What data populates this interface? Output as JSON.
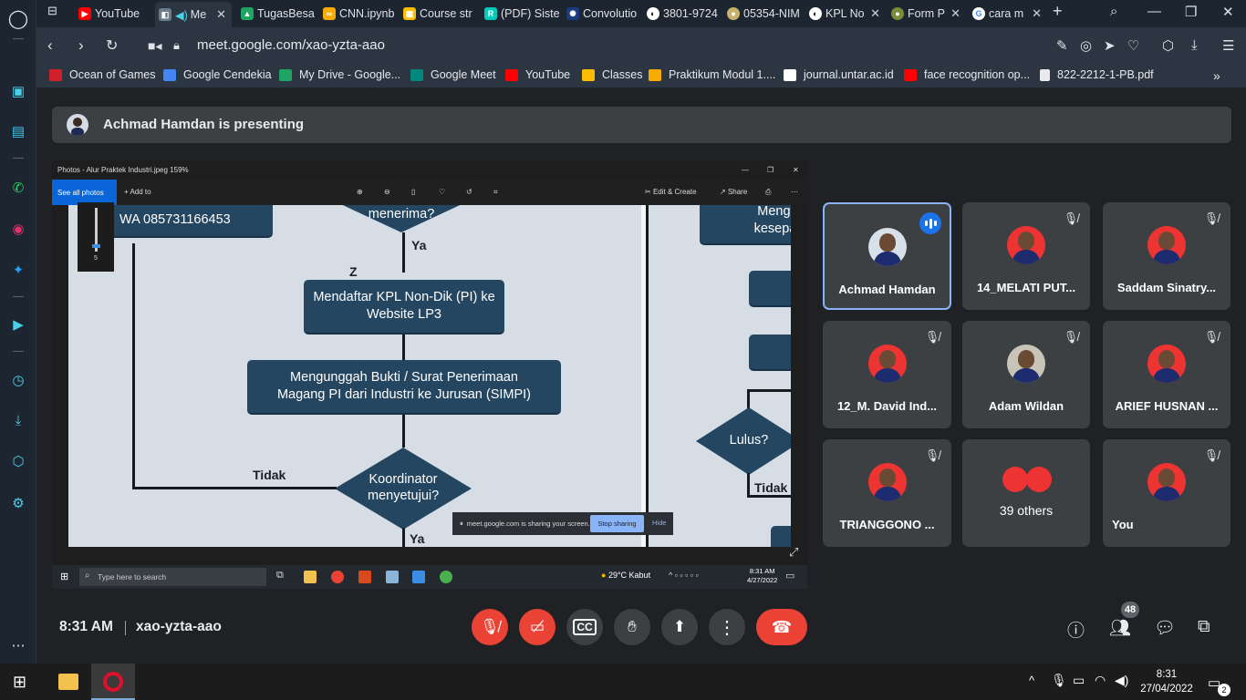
{
  "browser": {
    "tabs": [
      {
        "label": "YouTube",
        "color": "#ff0000"
      },
      {
        "label": "Me",
        "color": "#6b7c8c",
        "active": true
      },
      {
        "label": "TugasBesa",
        "color": "#1fa463"
      },
      {
        "label": "CNN.ipynb",
        "color": "#f9ab00"
      },
      {
        "label": "Course str",
        "color": "#fbbc04"
      },
      {
        "label": "(PDF) Siste",
        "color": "#00ccbb"
      },
      {
        "label": "Convolutio",
        "color": "#1a3b7c"
      },
      {
        "label": "3801-9724",
        "color": "#ffffff"
      },
      {
        "label": "05354-NIM",
        "color": "#c8b26a"
      },
      {
        "label": "KPL No",
        "color": "#ffffff"
      },
      {
        "label": "Form P",
        "color": "#7a8c3a"
      },
      {
        "label": "cara m",
        "color": "#4285f4"
      }
    ],
    "url": "meet.google.com/xao-yzta-aao",
    "bookmarks": [
      {
        "label": "Ocean of Games",
        "color": "#d0202a"
      },
      {
        "label": "Google Cendekia",
        "color": "#4285f4"
      },
      {
        "label": "My Drive - Google...",
        "color": "#1fa463"
      },
      {
        "label": "Google Meet",
        "color": "#00897b"
      },
      {
        "label": "YouTube",
        "color": "#ff0000"
      },
      {
        "label": "Classes",
        "color": "#fbbc04"
      },
      {
        "label": "Praktikum Modul 1....",
        "color": "#f9ab00"
      },
      {
        "label": "journal.untar.ac.id",
        "color": "#ffffff"
      },
      {
        "label": "face recognition op...",
        "color": "#ff0000"
      },
      {
        "label": "822-2212-1-PB.pdf",
        "color": "#e8eaed"
      }
    ]
  },
  "meet": {
    "presenter_text": "Achmad Hamdan is presenting",
    "shared": {
      "window_title": "Photos - Alur Praktek Industri.jpeg  159%",
      "see_all": "See all photos",
      "add_to": "+ Add to",
      "edit_create": "Edit & Create",
      "share": "Share",
      "zoom_value": "5",
      "flowchart": {
        "wa_box": "WA 085731166453",
        "diamond_top": "menerima?",
        "ya1": "Ya",
        "z": "Z",
        "box1": "Mendaftar KPL Non-Dik (PI) ke Website LP3",
        "box2": "Mengunggah Bukti / Surat Penerimaan Magang PI dari Industri ke Jurusan (SIMPI)",
        "tidak1": "Tidak",
        "diamond2": "Koordinator menyetujui?",
        "ya2": "Ya",
        "right_box_top": "Mengl kesepa",
        "lulus": "Lulus?",
        "tidak2": "Tidak"
      },
      "share_notice": "meet.google.com is sharing your screen.",
      "stop_sharing": "Stop sharing",
      "hide": "Hide",
      "win_search": "Type here to search",
      "weather": "29°C  Kabut",
      "win_time": "8:31 AM",
      "win_date": "4/27/2022"
    },
    "participants": [
      {
        "name": "Achmad Hamdan",
        "speaking": true
      },
      {
        "name": "14_MELATI PUT...",
        "muted": true
      },
      {
        "name": "Saddam Sinatry...",
        "muted": true
      },
      {
        "name": "12_M. David Ind...",
        "muted": true
      },
      {
        "name": "Adam Wildan",
        "muted": true
      },
      {
        "name": "ARIEF HUSNAN ...",
        "muted": true
      },
      {
        "name": "TRIANGGONO ...",
        "muted": true
      },
      {
        "name": "39 others"
      },
      {
        "name": "You",
        "muted": true
      }
    ],
    "time": "8:31 AM",
    "code": "xao-yzta-aao",
    "people_count": "48"
  },
  "taskbar": {
    "time": "8:31",
    "date": "27/04/2022",
    "notifications": "2"
  }
}
